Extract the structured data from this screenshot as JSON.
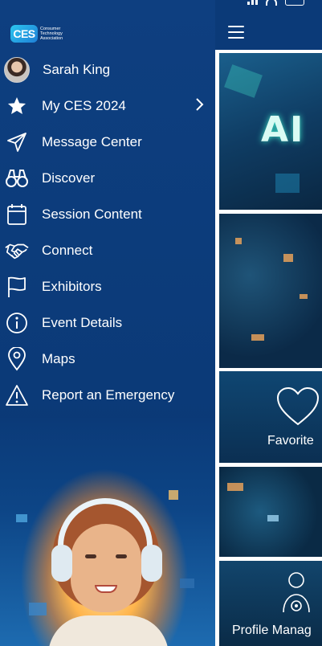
{
  "logo": {
    "mark_text": "CES",
    "subtitle_lines": [
      "Consumer",
      "Technology",
      "Association"
    ]
  },
  "menu": {
    "items": [
      {
        "label": "Sarah King",
        "icon": "avatar"
      },
      {
        "label": "My CES 2024",
        "icon": "star-icon",
        "has_chevron": true
      },
      {
        "label": "Message Center",
        "icon": "paper-plane-icon"
      },
      {
        "label": "Discover",
        "icon": "binoculars-icon"
      },
      {
        "label": "Session Content",
        "icon": "calendar-icon"
      },
      {
        "label": "Connect",
        "icon": "handshake-icon"
      },
      {
        "label": "Exhibitors",
        "icon": "flag-icon"
      },
      {
        "label": "Event Details",
        "icon": "info-icon"
      },
      {
        "label": "Maps",
        "icon": "map-pin-icon"
      },
      {
        "label": "Report an Emergency",
        "icon": "warning-icon"
      }
    ]
  },
  "peek": {
    "hero_text": "AI",
    "favorites_label": "Favorite",
    "profile_label": "Profile Manag"
  },
  "colors": {
    "drawer_background": "#0b3a78",
    "text": "#ffffff",
    "status_pill": "#e5213a"
  }
}
